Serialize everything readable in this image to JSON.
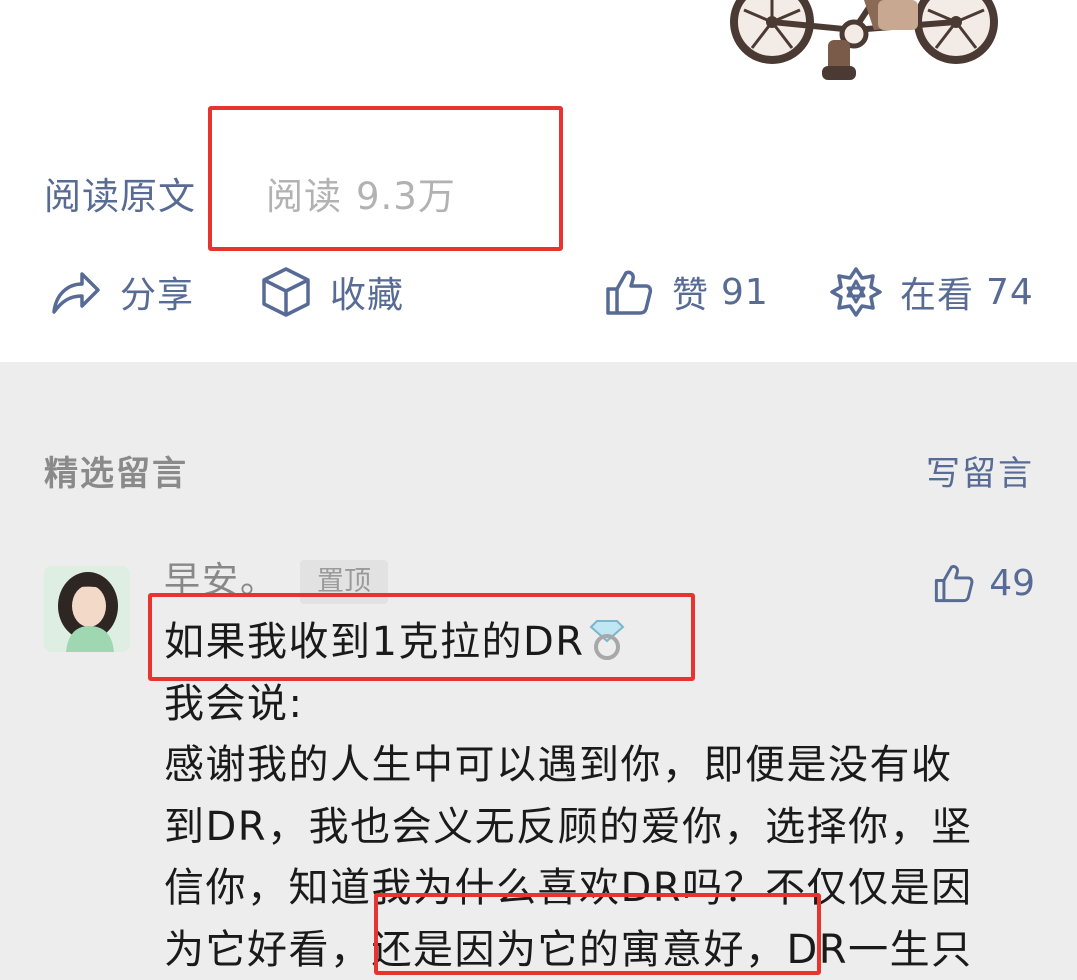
{
  "article_footer": {
    "read_original_label": "阅读原文",
    "read_label": "阅读",
    "read_count": "9.3万"
  },
  "actions": {
    "share": {
      "label": "分享",
      "icon": "share-icon"
    },
    "favorite": {
      "label": "收藏",
      "icon": "cube-icon"
    },
    "like": {
      "label": "赞",
      "count": "91",
      "icon": "thumbs-up-icon"
    },
    "watching": {
      "label": "在看",
      "count": "74",
      "icon": "star-flower-icon"
    }
  },
  "comments": {
    "section_title": "精选留言",
    "write_label": "写留言",
    "items": [
      {
        "nickname": "早安。",
        "pinned_label": "置顶",
        "likes": "49",
        "lines": [
          "如果我收到1克拉的DR",
          "我会说:",
          "感谢我的人生中可以遇到你，即便是没有收",
          "到DR，我也会义无反顾的爱你，选择你，坚",
          "信你，知道我为什么喜欢DR吗？不仅仅是因",
          "为它好看，还是因为它的寓意好，DR一生只"
        ]
      }
    ]
  },
  "colors": {
    "link_blue": "#576b95",
    "muted_gray": "#b2b2b2",
    "highlight_red": "#e8342f",
    "page_bg": "#ededed"
  }
}
